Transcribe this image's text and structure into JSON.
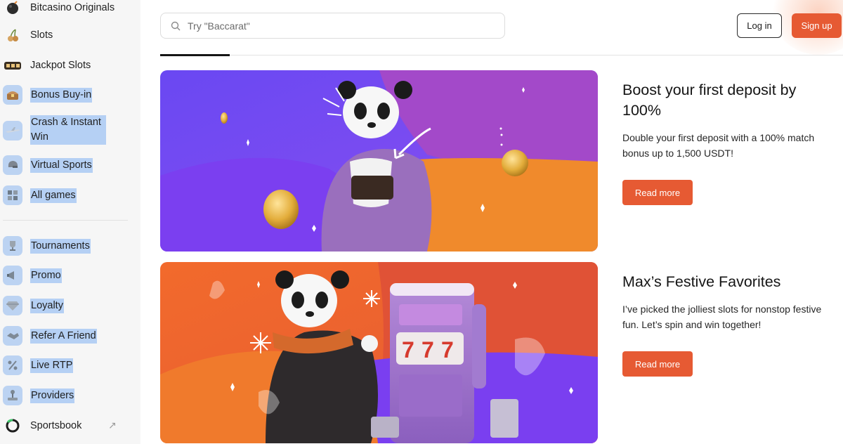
{
  "sidebar": {
    "items": [
      {
        "label": "Bitcasino Originals",
        "icon": "bomb-icon"
      },
      {
        "label": "Slots",
        "icon": "cherries-icon"
      },
      {
        "label": "Jackpot Slots",
        "icon": "jackpot-reels-icon"
      },
      {
        "label": "Bonus Buy-in",
        "icon": "treasure-chest-icon"
      },
      {
        "label": "Crash & Instant Win",
        "icon": "airplane-icon"
      },
      {
        "label": "Virtual Sports",
        "icon": "sports-helmet-icon"
      },
      {
        "label": "All games",
        "icon": "grid-icon"
      },
      {
        "label": "Tournaments",
        "icon": "trophy-icon"
      },
      {
        "label": "Promo",
        "icon": "megaphone-icon"
      },
      {
        "label": "Loyalty",
        "icon": "diamond-icon"
      },
      {
        "label": "Refer A Friend",
        "icon": "handshake-icon"
      },
      {
        "label": "Live RTP",
        "icon": "percent-icon"
      },
      {
        "label": "Providers",
        "icon": "joystick-icon"
      },
      {
        "label": "Sportsbook",
        "icon": "sportsbook-ring-icon"
      }
    ]
  },
  "header": {
    "search_placeholder": "Try \"Baccarat\"",
    "login_label": "Log in",
    "signup_label": "Sign up"
  },
  "promos": [
    {
      "title": "Boost your first deposit by 100%",
      "description": "Double your first deposit with a 100% match bonus up to 1,500 USDT!",
      "button_label": "Read more"
    },
    {
      "title": "Max’s Festive Favorites",
      "description": "I’ve picked the jolliest slots for nonstop festive fun. Let’s spin and win together!",
      "button_label": "Read more",
      "slot_reels": [
        "7",
        "7",
        "7"
      ]
    }
  ],
  "colors": {
    "accent": "#e65a33",
    "banner_purple": "#7048f0",
    "banner_orange": "#f08a2c",
    "selection_highlight": "#b5d0f4"
  }
}
